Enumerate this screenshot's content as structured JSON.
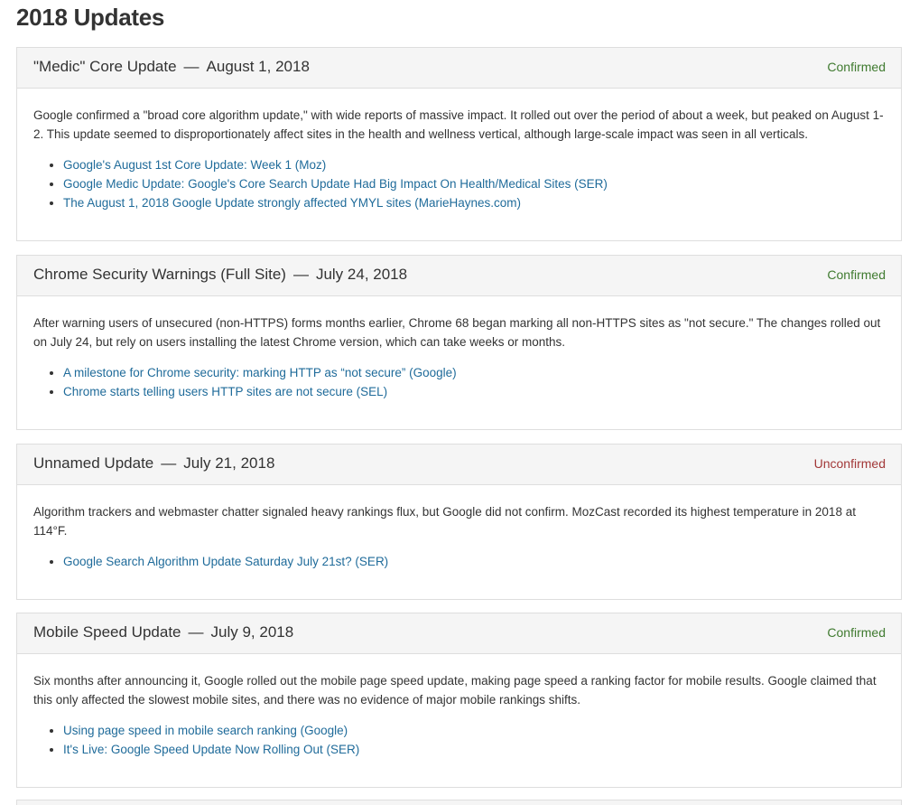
{
  "page": {
    "title": "2018 Updates"
  },
  "colors": {
    "link": "#1f6b9a",
    "confirmed": "#3f7a2f",
    "unconfirmed": "#a23838",
    "header_bg": "#f5f5f5",
    "border": "#dedede"
  },
  "updates": [
    {
      "name": "\"Medic\" Core Update",
      "separator": "—",
      "date": "August 1, 2018",
      "status": "Confirmed",
      "description": "Google confirmed a \"broad core algorithm update,\" with wide reports of massive impact. It rolled out over the period of about a week, but peaked on August 1-2. This update seemed to disproportionately affect sites in the health and wellness vertical, although large-scale impact was seen in all verticals.",
      "links": [
        "Google's August 1st Core Update: Week 1 (Moz)",
        "Google Medic Update: Google's Core Search Update Had Big Impact On Health/Medical Sites (SER)",
        "The August 1, 2018 Google Update strongly affected YMYL sites (MarieHaynes.com)"
      ]
    },
    {
      "name": "Chrome Security Warnings (Full Site)",
      "separator": "—",
      "date": "July 24, 2018",
      "status": "Confirmed",
      "description": "After warning users of unsecured (non-HTTPS) forms months earlier, Chrome 68 began marking all non-HTTPS sites as \"not secure.\" The changes rolled out on July 24, but rely on users installing the latest Chrome version, which can take weeks or months.",
      "links": [
        "A milestone for Chrome security: marking HTTP as “not secure” (Google)",
        "Chrome starts telling users HTTP sites are not secure (SEL)"
      ]
    },
    {
      "name": "Unnamed Update",
      "separator": "—",
      "date": "July 21, 2018",
      "status": "Unconfirmed",
      "description": "Algorithm trackers and webmaster chatter signaled heavy rankings flux, but Google did not confirm. MozCast recorded its highest temperature in 2018 at 114°F.",
      "links": [
        "Google Search Algorithm Update Saturday July 21st? (SER)"
      ]
    },
    {
      "name": "Mobile Speed Update",
      "separator": "—",
      "date": "July 9, 2018",
      "status": "Confirmed",
      "description": "Six months after announcing it, Google rolled out the mobile page speed update, making page speed a ranking factor for mobile results. Google claimed that this only affected the slowest mobile sites, and there was no evidence of major mobile rankings shifts.",
      "links": [
        "Using page speed in mobile search ranking (Google)",
        "It's Live: Google Speed Update Now Rolling Out (SER)"
      ]
    }
  ]
}
